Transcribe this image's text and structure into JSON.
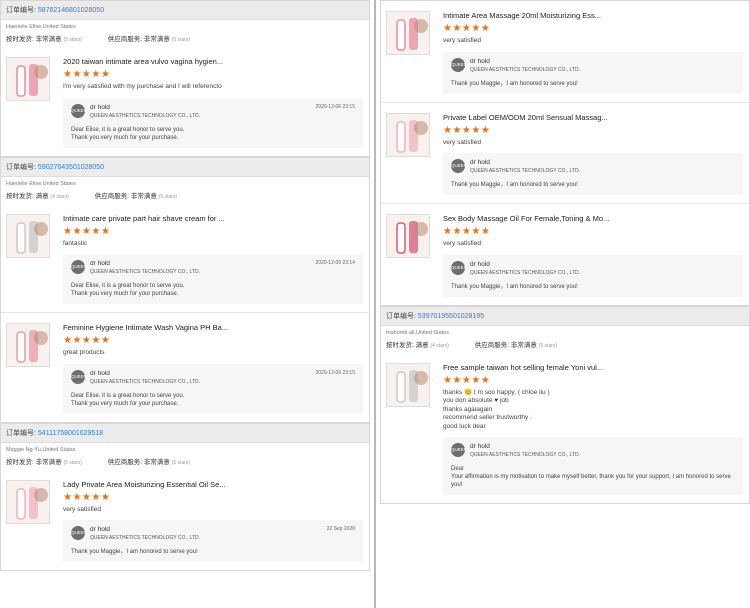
{
  "order_label": "订单编号:",
  "rating_labels": {
    "item_match": "按时发货:",
    "supplier_service": "供应商服务:"
  },
  "seller": {
    "name": "dr hold",
    "company": "QUEEN AESTHETICS TECHNOLOGY CO., LTD.",
    "avatar_text": "QUEEN"
  },
  "left_orders": [
    {
      "number": "5876214680102805​0",
      "buyer": "Haerielie Elise,United States",
      "rating1": "非常满意",
      "rating1_stars": "(5 stars)",
      "rating2": "非常满意",
      "rating2_stars": "(5 stars)",
      "items": [
        {
          "title": "2020 taiwan intimate area vulvo vagina hygien...",
          "stars": "★★★★★",
          "comment": "I'm very satisfied with my purchase and I will referencto",
          "date": "2020-12-06 23:15",
          "reply": "Dear  Elise, it is a great honor to serve you.\nThank you very much for your purchase."
        }
      ]
    },
    {
      "number": "5902764350102805​0",
      "buyer": "Haerielie Elise,United States",
      "rating1": "满意",
      "rating1_stars": "(4 stars)",
      "rating2": "非常满意",
      "rating2_stars": "(5 stars)",
      "items": [
        {
          "title": "Intimate care private part hair shave cream for ...",
          "stars": "★★★★★",
          "comment": "fantastic",
          "date": "2020-12-09 23:14",
          "reply": "Dear  Elise, it is a great honor to serve you.\nThank you very much for your purchase."
        },
        {
          "title": "Feminine Hygiene Intimate Wash Vagina PH Ba...",
          "stars": "★★★★★",
          "comment": "great products",
          "date": "2020-12-09 23:15",
          "reply": "Dear  Elise, it is a great honor to serve you.\nThank you very much for your purchase."
        }
      ]
    },
    {
      "number": "5411175800102951​8",
      "buyer": "Maggie Ng-Yu,United States",
      "rating1": "非常满意",
      "rating1_stars": "(5 stars)",
      "rating2": "非常满意",
      "rating2_stars": "(5 stars)",
      "items": [
        {
          "title": "Lady Private Area Moisturizing Essential Oil Se...",
          "stars": "★★★★★",
          "comment": "very satisfied",
          "date": "22 Sep 2020",
          "reply": "Thank you Maggie，I am honored to serve you!"
        }
      ]
    }
  ],
  "right_orders": [
    {
      "number": null,
      "items": [
        {
          "title": "Intimate Area Massage 20ml Moisturizing Ess...",
          "stars": "★★★★★",
          "comment": "very satisfied",
          "date": "",
          "reply": "Thank you Maggie，I am honored to serve you!"
        },
        {
          "title": "Private Label OEM/ODM 20ml Sensual Massag...",
          "stars": "★★★★★",
          "comment": "very satisfied",
          "date": "",
          "reply": "Thank you Maggie，I am honored to serve you!"
        },
        {
          "title": "Sex Body Massage Oil For Female,Toning & Mo...",
          "stars": "★★★★★",
          "comment": "very satisfied",
          "date": "",
          "reply": "Thank you Maggie，I am honored to serve you!"
        }
      ]
    },
    {
      "number": "53970195501028195",
      "buyer": "mahomb ali,United States",
      "rating1": "满意",
      "rating1_stars": "(4 stars)",
      "rating2": "非常满意",
      "rating2_stars": "(5 stars)",
      "items": [
        {
          "title": "Free sample taiwan hot selling female Yoni vul...",
          "stars": "★★★★★",
          "comment": "thanks 😊 I m soo happy, ( chloe liu )\nyou don absolute ♥ job\nthanks agaiagain\nrecommend seller trustworthy .\ngood luck dear",
          "date": "",
          "reply": "Dear\nYour affirmation is my motivation to make myself better, thank you for your support, I am honored to serve you!"
        }
      ]
    }
  ]
}
